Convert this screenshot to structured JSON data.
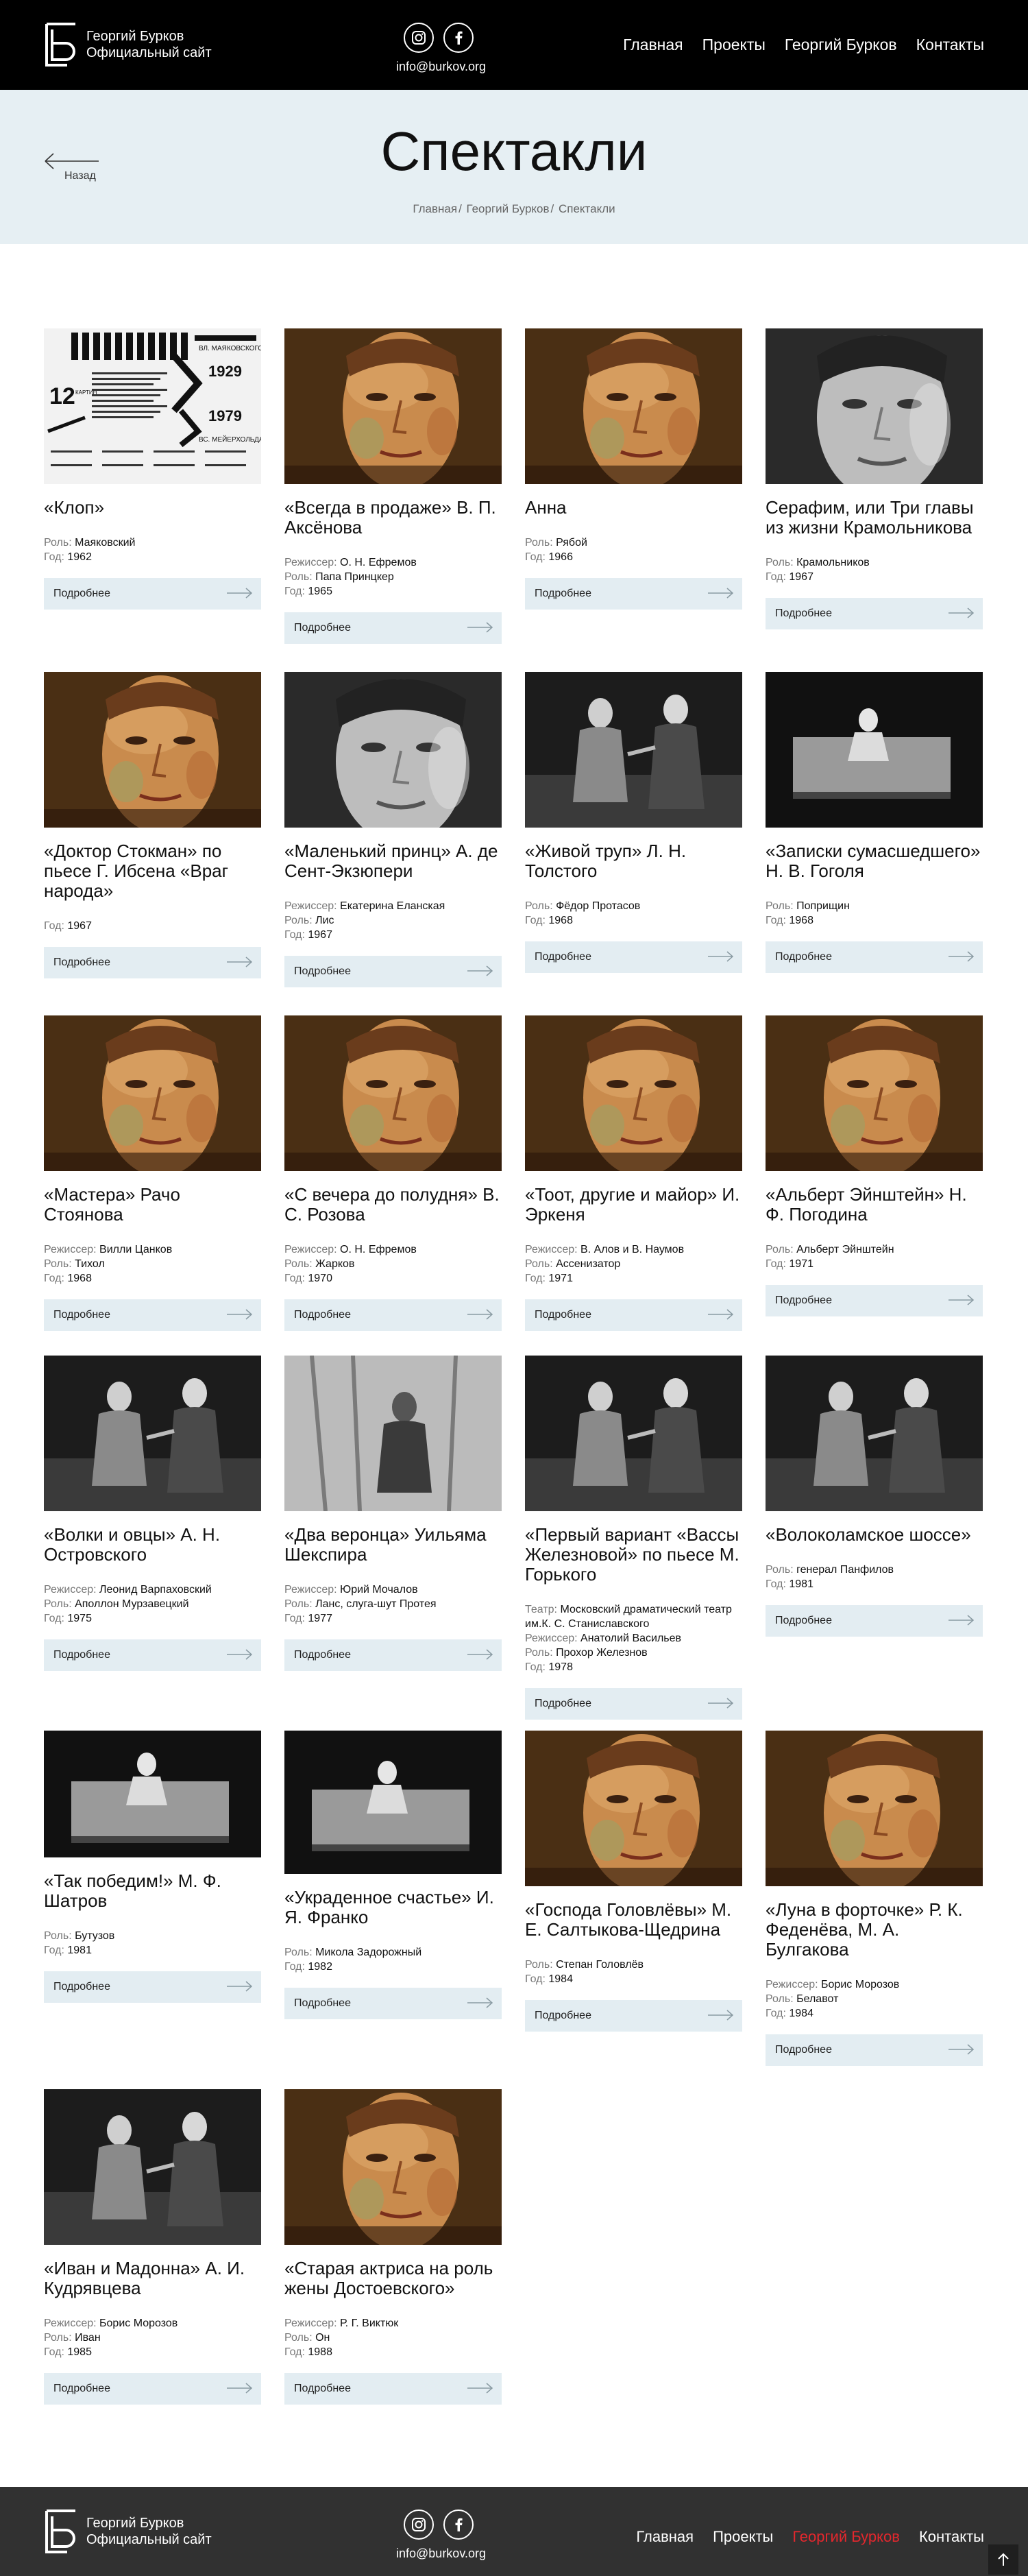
{
  "header": {
    "logo_line1": "Георгий Бурков",
    "logo_line2": "Официальный сайт",
    "email": "info@burkov.org",
    "nav": [
      "Главная",
      "Проекты",
      "Георгий Бурков",
      "Контакты"
    ]
  },
  "hero": {
    "back_label": "Назад",
    "title": "Спектакли",
    "breadcrumbs": [
      "Главная",
      "Георгий Бурков",
      "Спектакли"
    ]
  },
  "cards": [
    {
      "title": "«Клоп»",
      "meta": [
        {
          "k": "Роль:",
          "v": "Маяковский"
        },
        {
          "k": "Год:",
          "v": "1962"
        }
      ],
      "image": "poster"
    },
    {
      "title": "«Всегда в продаже» В. П. Аксёнова",
      "meta": [
        {
          "k": "Режиссер:",
          "v": "О. Н. Ефремов"
        },
        {
          "k": "Роль:",
          "v": "Папа Принцкер"
        },
        {
          "k": "Год:",
          "v": "1965"
        }
      ],
      "image": "portrait"
    },
    {
      "title": "Анна",
      "meta": [
        {
          "k": "Роль:",
          "v": "Рябой"
        },
        {
          "k": "Год:",
          "v": "1966"
        }
      ],
      "image": "portrait"
    },
    {
      "title": "Серафим, или Три главы из жизни Крамольникова",
      "meta": [
        {
          "k": "Роль:",
          "v": "Крамольников"
        },
        {
          "k": "Год:",
          "v": "1967"
        }
      ],
      "image": "bw-face"
    },
    {
      "title": "«Доктор Стокман» по пьесе Г. Ибсена «Враг народа»",
      "meta": [
        {
          "k": "Год:",
          "v": "1967"
        }
      ],
      "image": "portrait"
    },
    {
      "title": "«Маленький принц» А. де Сент-Экзюпери",
      "meta": [
        {
          "k": "Режиссер:",
          "v": "Екатерина Еланская"
        },
        {
          "k": "Роль:",
          "v": "Лис"
        },
        {
          "k": "Год:",
          "v": "1967"
        }
      ],
      "image": "bw-face"
    },
    {
      "title": "«Живой труп» Л. Н. Толстого",
      "meta": [
        {
          "k": "Роль:",
          "v": "Фёдор Протасов"
        },
        {
          "k": "Год:",
          "v": "1968"
        }
      ],
      "image": "bw-scene"
    },
    {
      "title": "«Записки сумасшедшего» Н. В. Гоголя",
      "meta": [
        {
          "k": "Роль:",
          "v": "Поприщин"
        },
        {
          "k": "Год:",
          "v": "1968"
        }
      ],
      "image": "bw-dark"
    },
    {
      "title": "«Мастера» Рачо Стоянова",
      "meta": [
        {
          "k": "Режиссер:",
          "v": "Вилли Цанков"
        },
        {
          "k": "Роль:",
          "v": "Тихол"
        },
        {
          "k": "Год:",
          "v": "1968"
        }
      ],
      "image": "portrait"
    },
    {
      "title": "«С вечера до полудня» В. С. Розова",
      "meta": [
        {
          "k": "Режиссер:",
          "v": "О. Н. Ефремов"
        },
        {
          "k": "Роль:",
          "v": "Жарков"
        },
        {
          "k": "Год:",
          "v": "1970"
        }
      ],
      "image": "portrait"
    },
    {
      "title": "«Тоот, другие и майор» И. Эркеня",
      "meta": [
        {
          "k": "Режиссер:",
          "v": "В. Алов и В. Наумов"
        },
        {
          "k": "Роль:",
          "v": "Ассенизатор"
        },
        {
          "k": "Год:",
          "v": "1971"
        }
      ],
      "image": "portrait"
    },
    {
      "title": "«Альберт Эйнштейн» Н. Ф. Погодина",
      "meta": [
        {
          "k": "Роль:",
          "v": "Альберт Эйнштейн"
        },
        {
          "k": "Год:",
          "v": "1971"
        }
      ],
      "image": "portrait"
    },
    {
      "title": "«Волки и овцы» А. Н. Островского",
      "meta": [
        {
          "k": "Режиссер:",
          "v": "Леонид Варпаховский"
        },
        {
          "k": "Роль:",
          "v": "Аполлон Мурзавецкий"
        },
        {
          "k": "Год:",
          "v": "1975"
        }
      ],
      "image": "bw-scene"
    },
    {
      "title": "«Два веронца» Уильяма Шекспира",
      "meta": [
        {
          "k": "Режиссер:",
          "v": "Юрий Мочалов"
        },
        {
          "k": "Роль:",
          "v": "Ланс, слуга-шут Протея"
        },
        {
          "k": "Год:",
          "v": "1977"
        }
      ],
      "image": "bw-light"
    },
    {
      "title": "«Первый вариант «Вассы Железновой» по пьесе М. Горького",
      "meta": [
        {
          "k": "Театр:",
          "v": "Московский драматический театр им.К. С. Станиславского"
        },
        {
          "k": "Режиссер:",
          "v": "Анатолий Васильев"
        },
        {
          "k": "Роль:",
          "v": "Прохор Железнов"
        },
        {
          "k": "Год:",
          "v": "1978"
        }
      ],
      "image": "bw-scene"
    },
    {
      "title": "«Волоколамское шоссе»",
      "meta": [
        {
          "k": "Роль:",
          "v": "генерал Панфилов"
        },
        {
          "k": "Год:",
          "v": "1981"
        }
      ],
      "image": "bw-scene"
    },
    {
      "title": "«Так победим!» М. Ф. Шатров",
      "meta": [
        {
          "k": "Роль:",
          "v": "Бутузов"
        },
        {
          "k": "Год:",
          "v": "1981"
        }
      ],
      "image": "bw-dark"
    },
    {
      "title": "«Украденное счастье» И. Я. Франко",
      "meta": [
        {
          "k": "Роль:",
          "v": "Микола Задорожный"
        },
        {
          "k": "Год:",
          "v": "1982"
        }
      ],
      "image": "bw-dark"
    },
    {
      "title": "«Господа Головлёвы» М. Е. Салтыкова-Щедрина",
      "meta": [
        {
          "k": "Роль:",
          "v": "Степан Головлёв"
        },
        {
          "k": "Год:",
          "v": "1984"
        }
      ],
      "image": "portrait"
    },
    {
      "title": "«Луна в форточке» Р. К. Феденёва, М. А. Булгакова",
      "meta": [
        {
          "k": "Режиссер:",
          "v": "Борис Морозов"
        },
        {
          "k": "Роль:",
          "v": "Белавот"
        },
        {
          "k": "Год:",
          "v": "1984"
        }
      ],
      "image": "portrait"
    },
    {
      "title": "«Иван и Мадонна» А. И. Кудрявцева",
      "meta": [
        {
          "k": "Режиссер:",
          "v": "Борис Морозов"
        },
        {
          "k": "Роль:",
          "v": "Иван"
        },
        {
          "k": "Год:",
          "v": "1985"
        }
      ],
      "image": "bw-scene"
    },
    {
      "title": "«Старая актриса на роль жены Достоевского»",
      "meta": [
        {
          "k": "Режиссер:",
          "v": "Р. Г. Виктюк"
        },
        {
          "k": "Роль:",
          "v": "Он"
        },
        {
          "k": "Год:",
          "v": "1988"
        }
      ],
      "image": "portrait"
    }
  ],
  "more_label": "Подробнее",
  "poster": {
    "line1": "ВЛ. МАЯКОВСКОГО",
    "line2": "1929",
    "line3": "1979",
    "line4": "ВС. МЕЙЕРХОЛЬДА",
    "side_big": "12",
    "side_small": "КАРТИН"
  },
  "footer": {
    "logo_line1": "Георгий Бурков",
    "logo_line2": "Официальный сайт",
    "email": "info@burkov.org",
    "nav": [
      "Главная",
      "Проекты",
      "Георгий Бурков",
      "Контакты"
    ],
    "active_nav_color": "#e3272d"
  },
  "colors": {
    "header_bg": "#000000",
    "hero_bg": "#e6eff3",
    "button_bg": "#e3edf2",
    "footer_bg": "#313131"
  }
}
